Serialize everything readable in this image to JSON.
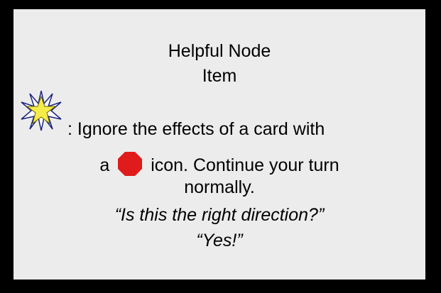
{
  "card": {
    "title": "Helpful Node",
    "type": "Item",
    "icons": {
      "ability_icon": "star-icon",
      "target_icon": "stop-octagon-icon"
    },
    "colors": {
      "background": "#ececec",
      "frame": "#000000",
      "star_fill": "#f5ec4a",
      "star_outline": "#1a237e",
      "stop_fill": "#e01b1b"
    },
    "ability_text_line1": ": Ignore the effects of a card with",
    "ability_text_line2_a": "a",
    "ability_text_line2_b": "icon.  Continue your turn",
    "ability_text_line3": "normally.",
    "flavor_line1": "“Is this the right direction?”",
    "flavor_line2": "“Yes!”"
  }
}
